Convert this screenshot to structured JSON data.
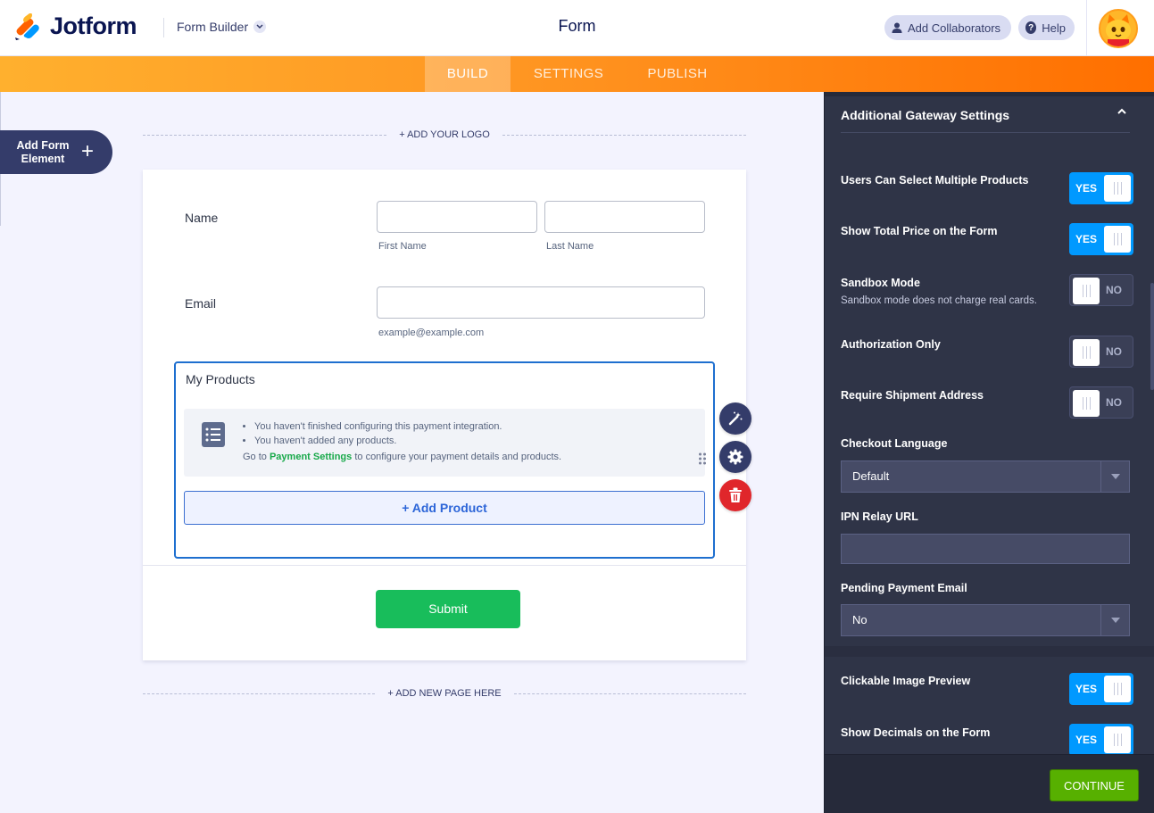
{
  "header": {
    "brand": "Jotform",
    "builder_dropdown": "Form Builder",
    "title": "Form",
    "collaborators_label": "Add Collaborators",
    "help_label": "Help"
  },
  "tabs": [
    {
      "label": "BUILD",
      "active": true
    },
    {
      "label": "SETTINGS",
      "active": false
    },
    {
      "label": "PUBLISH",
      "active": false
    }
  ],
  "left": {
    "add_element_label": "Add Form Element",
    "add_logo_label": "+ ADD YOUR LOGO",
    "add_page_label": "+ ADD NEW PAGE HERE"
  },
  "form": {
    "name_label": "Name",
    "first_name_sub": "First Name",
    "last_name_sub": "Last Name",
    "email_label": "Email",
    "email_sub": "example@example.com",
    "products": {
      "title": "My Products",
      "warnings": [
        "You haven't finished configuring this payment integration.",
        "You haven't added any products."
      ],
      "goto_prefix": "Go to ",
      "goto_link": "Payment Settings",
      "goto_suffix": " to configure your payment details and products.",
      "add_product_label": "+ Add Product"
    },
    "submit_label": "Submit"
  },
  "panel": {
    "heading": "Additional Gateway Settings",
    "settings": [
      {
        "label": "Users Can Select Multiple Products",
        "value": "YES"
      },
      {
        "label": "Show Total Price on the Form",
        "value": "YES"
      },
      {
        "label": "Sandbox Mode",
        "sub": "Sandbox mode does not charge real cards.",
        "value": "NO"
      },
      {
        "label": "Authorization Only",
        "value": "NO"
      },
      {
        "label": "Require Shipment Address",
        "value": "NO"
      }
    ],
    "checkout_language": {
      "label": "Checkout Language",
      "value": "Default"
    },
    "ipn_relay": {
      "label": "IPN Relay URL",
      "value": ""
    },
    "pending_email": {
      "label": "Pending Payment Email",
      "value": "No"
    },
    "settings2": [
      {
        "label": "Clickable Image Preview",
        "value": "YES"
      },
      {
        "label": "Show Decimals on the Form",
        "value": "YES"
      }
    ],
    "continue_label": "CONTINUE"
  },
  "colors": {
    "brand_navy": "#0a1551",
    "tab_gradient_start": "#ffb02e",
    "tab_gradient_end": "#ff6f00",
    "toggle_on": "#0099ff",
    "submit_green": "#18bd5b",
    "continue_green": "#57b000",
    "delete_red": "#e0262b"
  }
}
